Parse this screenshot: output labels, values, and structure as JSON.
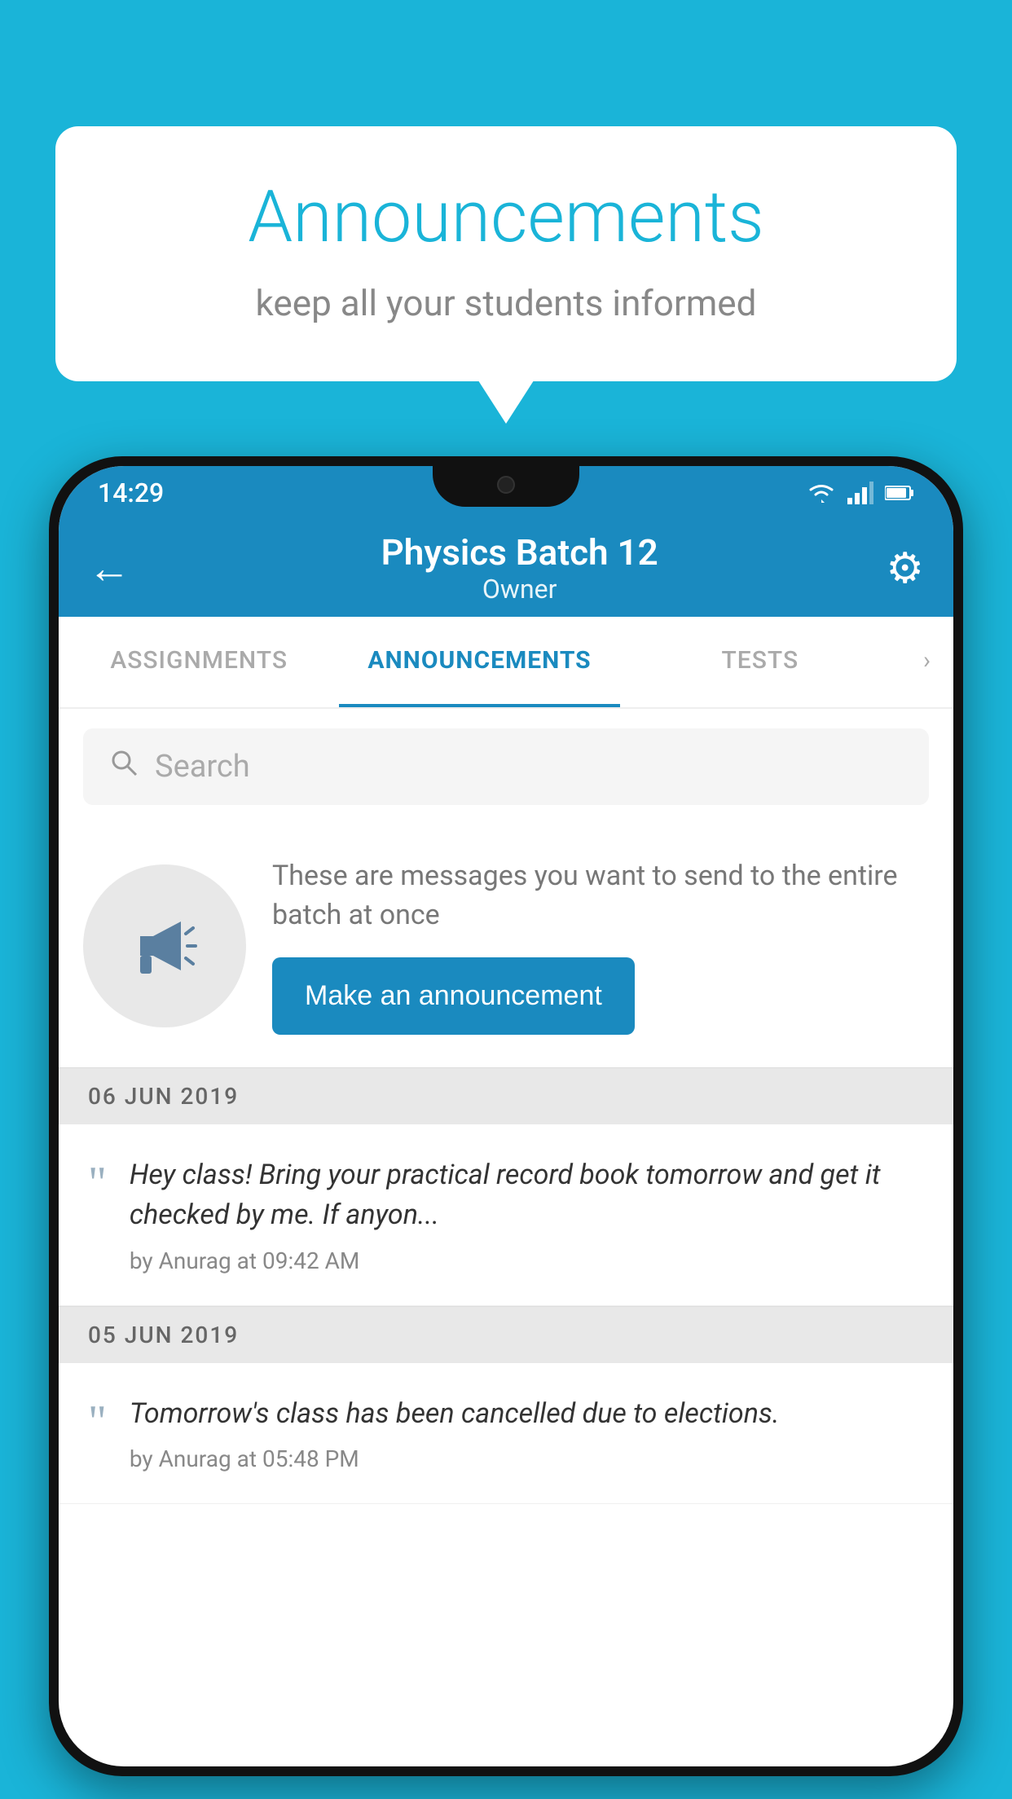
{
  "bubble": {
    "title": "Announcements",
    "subtitle": "keep all your students informed"
  },
  "phone": {
    "status_bar": {
      "time": "14:29",
      "icons": [
        "wifi",
        "signal",
        "battery"
      ]
    },
    "app_bar": {
      "title": "Physics Batch 12",
      "subtitle": "Owner",
      "back_label": "←",
      "settings_label": "⚙"
    },
    "tabs": [
      {
        "label": "ASSIGNMENTS",
        "active": false
      },
      {
        "label": "ANNOUNCEMENTS",
        "active": true
      },
      {
        "label": "TESTS",
        "active": false
      }
    ],
    "search": {
      "placeholder": "Search"
    },
    "announcement_prompt": {
      "description": "These are messages you want to send to the entire batch at once",
      "button_label": "Make an announcement"
    },
    "announcements": [
      {
        "date": "06  JUN  2019",
        "text": "Hey class! Bring your practical record book tomorrow and get it checked by me. If anyon...",
        "meta": "by Anurag at 09:42 AM"
      },
      {
        "date": "05  JUN  2019",
        "text": "Tomorrow's class has been cancelled due to elections.",
        "meta": "by Anurag at 05:48 PM"
      }
    ]
  },
  "colors": {
    "primary": "#1a8abf",
    "background": "#1ab4d8",
    "accent": "#1a8abf",
    "text_dark": "#333",
    "text_muted": "#888"
  }
}
